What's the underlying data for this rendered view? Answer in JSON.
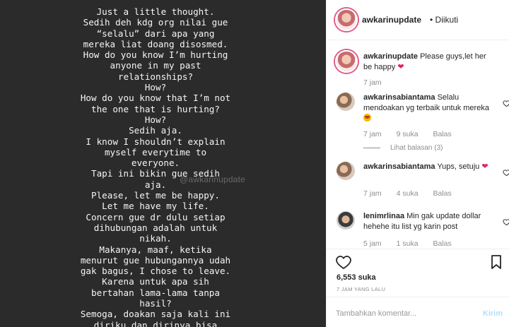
{
  "post": {
    "story_text": "Just a little thought.\nSedih deh kdg org nilai gue\n“selalu” dari apa yang\nmereka liat doang disosmed.\nHow do you know I’m hurting\nanyone in my past\nrelationships?\nHow?\nHow do you know that I’m not\nthe one that is hurting?\nHow?\nSedih aja.\nI know I shouldn’t explain\nmyself everytime to\neveryone.\nTapi ini bikin gue sedih\naja.\nPlease, let me be happy.\nLet me have my life.\nConcern gue dr dulu setiap\ndihubungan adalah untuk\nnikah.\nMakanya, maaf, ketika\nmenurut gue hubungannya udah\ngak bagus, I chose to leave.\nKarena untuk apa sih\nbertahan lama-lama tanpa\nhasil?\nSemoga, doakan saja kali ini\ndiriku dan dirinya bisa\nmenghasilkan sesuatu.",
    "watermark": "@awkarinupdate"
  },
  "header": {
    "username": "awkarinupdate",
    "follow_status": "• Diikuti"
  },
  "comments": [
    {
      "username": "awkarinupdate",
      "text": "Please guys,let her be happy",
      "emoji": "❤",
      "time": "7 jam",
      "likes": "",
      "reply": ""
    },
    {
      "username": "awkarinsabiantama",
      "text": "Selalu mendoakan yg terbaik untuk mereka",
      "emoji": "smile",
      "time": "7 jam",
      "likes": "9 suka",
      "reply": "Balas",
      "view_replies": "Lihat balasan (3)"
    },
    {
      "username": "awkarinsabiantama",
      "text": "Yups, setuju",
      "emoji": "❤",
      "time": "7 jam",
      "likes": "4 suka",
      "reply": "Balas"
    },
    {
      "username": "lenimrlinaa",
      "text": "Min gak update dollar hehehe itu list yg karin post",
      "emoji": "",
      "time": "5 jam",
      "likes": "1 suka",
      "reply": "Balas"
    }
  ],
  "actions": {
    "likes": "6,553 suka",
    "timestamp": "7 JAM YANG LALU"
  },
  "add_comment": {
    "placeholder": "Tambahkan komentar...",
    "post_label": "Kirim"
  },
  "colors": {
    "heart": "#e0245e",
    "post_button_disabled": "#b2dffc",
    "meta_gray": "#8e8e8e"
  }
}
